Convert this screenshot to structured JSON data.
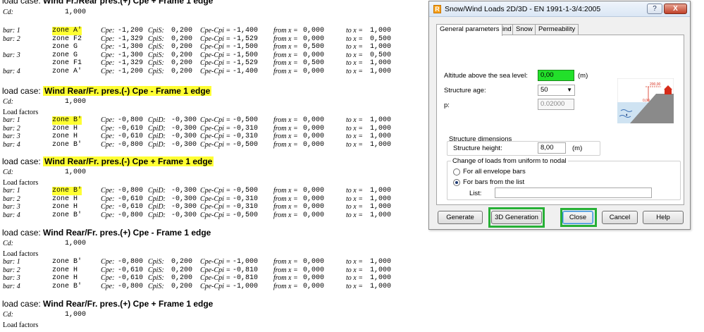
{
  "report": {
    "sections": [
      {
        "title_prefix": "load case:",
        "title": "Wind Fr./Rear pres.(+) Cpe + Frame 1 edge",
        "title_highlight": false,
        "cd_label": "Cd:",
        "cd_value": "1,000",
        "load_factors_label": null,
        "rows": [
          {
            "bar": "bar: 1",
            "zone": "zone A'",
            "zone_highlight": true,
            "cpe_label": "Cpe:",
            "cpe": "-1,200",
            "cpi_label": "CpiS:",
            "cpi": "0,200",
            "pmi_label": "Cpe-Cpi =",
            "pmi": "-1,400",
            "from_label": "from x =",
            "from": "0,000",
            "to_label": "to x =",
            "to": "1,000"
          },
          {
            "bar": "bar: 2",
            "zone": "zone F2",
            "zone_highlight": false,
            "cpe_label": "Cpe:",
            "cpe": "-1,329",
            "cpi_label": "CpiS:",
            "cpi": "0,200",
            "pmi_label": "Cpe-Cpi =",
            "pmi": "-1,529",
            "from_label": "from x =",
            "from": "0,000",
            "to_label": "to x =",
            "to": "0,500"
          },
          {
            "bar": "",
            "zone": "zone G",
            "zone_highlight": false,
            "cpe_label": "Cpe:",
            "cpe": "-1,300",
            "cpi_label": "CpiS:",
            "cpi": "0,200",
            "pmi_label": "Cpe-Cpi =",
            "pmi": "-1,500",
            "from_label": "from x =",
            "from": "0,500",
            "to_label": "to x =",
            "to": "1,000"
          },
          {
            "bar": "bar: 3",
            "zone": "zone G",
            "zone_highlight": false,
            "cpe_label": "Cpe:",
            "cpe": "-1,300",
            "cpi_label": "CpiS:",
            "cpi": "0,200",
            "pmi_label": "Cpe-Cpi =",
            "pmi": "-1,500",
            "from_label": "from x =",
            "from": "0,000",
            "to_label": "to x =",
            "to": "0,500"
          },
          {
            "bar": "",
            "zone": "zone F1",
            "zone_highlight": false,
            "cpe_label": "Cpe:",
            "cpe": "-1,329",
            "cpi_label": "CpiS:",
            "cpi": "0,200",
            "pmi_label": "Cpe-Cpi =",
            "pmi": "-1,529",
            "from_label": "from x =",
            "from": "0,500",
            "to_label": "to x =",
            "to": "1,000"
          },
          {
            "bar": "bar: 4",
            "zone": "zone A'",
            "zone_highlight": false,
            "cpe_label": "Cpe:",
            "cpe": "-1,200",
            "cpi_label": "CpiS:",
            "cpi": "0,200",
            "pmi_label": "Cpe-Cpi =",
            "pmi": "-1,400",
            "from_label": "from x =",
            "from": "0,000",
            "to_label": "to x =",
            "to": "1,000"
          }
        ]
      },
      {
        "title_prefix": "load case:",
        "title": "Wind Rear/Fr. pres.(-) Cpe - Frame 1 edge",
        "title_highlight": true,
        "cd_label": "Cd:",
        "cd_value": "1,000",
        "load_factors_label": "Load factors",
        "rows": [
          {
            "bar": "bar: 1",
            "zone": "zone B'",
            "zone_highlight": true,
            "cpe_label": "Cpe:",
            "cpe": "-0,800",
            "cpi_label": "CpiD:",
            "cpi": "-0,300",
            "pmi_label": "Cpe-Cpi =",
            "pmi": "-0,500",
            "from_label": "from x =",
            "from": "0,000",
            "to_label": "to x =",
            "to": "1,000"
          },
          {
            "bar": "bar: 2",
            "zone": "zone H",
            "zone_highlight": false,
            "cpe_label": "Cpe:",
            "cpe": "-0,610",
            "cpi_label": "CpiD:",
            "cpi": "-0,300",
            "pmi_label": "Cpe-Cpi =",
            "pmi": "-0,310",
            "from_label": "from x =",
            "from": "0,000",
            "to_label": "to x =",
            "to": "1,000"
          },
          {
            "bar": "bar: 3",
            "zone": "zone H",
            "zone_highlight": false,
            "cpe_label": "Cpe:",
            "cpe": "-0,610",
            "cpi_label": "CpiD:",
            "cpi": "-0,300",
            "pmi_label": "Cpe-Cpi =",
            "pmi": "-0,310",
            "from_label": "from x =",
            "from": "0,000",
            "to_label": "to x =",
            "to": "1,000"
          },
          {
            "bar": "bar: 4",
            "zone": "zone B'",
            "zone_highlight": false,
            "cpe_label": "Cpe:",
            "cpe": "-0,800",
            "cpi_label": "CpiD:",
            "cpi": "-0,300",
            "pmi_label": "Cpe-Cpi =",
            "pmi": "-0,500",
            "from_label": "from x =",
            "from": "0,000",
            "to_label": "to x =",
            "to": "1,000"
          }
        ]
      },
      {
        "title_prefix": "load case:",
        "title": "Wind Rear/Fr. pres.(-) Cpe + Frame 1 edge",
        "title_highlight": true,
        "cd_label": "Cd:",
        "cd_value": "1,000",
        "load_factors_label": "Load factors",
        "rows": [
          {
            "bar": "bar: 1",
            "zone": "zone B'",
            "zone_highlight": true,
            "cpe_label": "Cpe:",
            "cpe": "-0,800",
            "cpi_label": "CpiD:",
            "cpi": "-0,300",
            "pmi_label": "Cpe-Cpi =",
            "pmi": "-0,500",
            "from_label": "from x =",
            "from": "0,000",
            "to_label": "to x =",
            "to": "1,000"
          },
          {
            "bar": "bar: 2",
            "zone": "zone H",
            "zone_highlight": false,
            "cpe_label": "Cpe:",
            "cpe": "-0,610",
            "cpi_label": "CpiD:",
            "cpi": "-0,300",
            "pmi_label": "Cpe-Cpi =",
            "pmi": "-0,310",
            "from_label": "from x =",
            "from": "0,000",
            "to_label": "to x =",
            "to": "1,000"
          },
          {
            "bar": "bar: 3",
            "zone": "zone H",
            "zone_highlight": false,
            "cpe_label": "Cpe:",
            "cpe": "-0,610",
            "cpi_label": "CpiD:",
            "cpi": "-0,300",
            "pmi_label": "Cpe-Cpi =",
            "pmi": "-0,310",
            "from_label": "from x =",
            "from": "0,000",
            "to_label": "to x =",
            "to": "1,000"
          },
          {
            "bar": "bar: 4",
            "zone": "zone B'",
            "zone_highlight": false,
            "cpe_label": "Cpe:",
            "cpe": "-0,800",
            "cpi_label": "CpiD:",
            "cpi": "-0,300",
            "pmi_label": "Cpe-Cpi =",
            "pmi": "-0,500",
            "from_label": "from x =",
            "from": "0,000",
            "to_label": "to x =",
            "to": "1,000"
          }
        ]
      },
      {
        "title_prefix": "load case:",
        "title": "Wind Rear/Fr. pres.(+) Cpe - Frame 1 edge",
        "title_highlight": false,
        "cd_label": "Cd:",
        "cd_value": "1,000",
        "load_factors_label": "Load factors",
        "rows": [
          {
            "bar": "bar: 1",
            "zone": "zone B'",
            "zone_highlight": false,
            "cpe_label": "Cpe:",
            "cpe": "-0,800",
            "cpi_label": "CpiS:",
            "cpi": "0,200",
            "pmi_label": "Cpe-Cpi =",
            "pmi": "-1,000",
            "from_label": "from x =",
            "from": "0,000",
            "to_label": "to x =",
            "to": "1,000"
          },
          {
            "bar": "bar: 2",
            "zone": "zone H",
            "zone_highlight": false,
            "cpe_label": "Cpe:",
            "cpe": "-0,610",
            "cpi_label": "CpiS:",
            "cpi": "0,200",
            "pmi_label": "Cpe-Cpi =",
            "pmi": "-0,810",
            "from_label": "from x =",
            "from": "0,000",
            "to_label": "to x =",
            "to": "1,000"
          },
          {
            "bar": "bar: 3",
            "zone": "zone H",
            "zone_highlight": false,
            "cpe_label": "Cpe:",
            "cpe": "-0,610",
            "cpi_label": "CpiS:",
            "cpi": "0,200",
            "pmi_label": "Cpe-Cpi =",
            "pmi": "-0,810",
            "from_label": "from x =",
            "from": "0,000",
            "to_label": "to x =",
            "to": "1,000"
          },
          {
            "bar": "bar: 4",
            "zone": "zone B'",
            "zone_highlight": false,
            "cpe_label": "Cpe:",
            "cpe": "-0,800",
            "cpi_label": "CpiS:",
            "cpi": "0,200",
            "pmi_label": "Cpe-Cpi =",
            "pmi": "-1,000",
            "from_label": "from x =",
            "from": "0,000",
            "to_label": "to x =",
            "to": "1,000"
          }
        ]
      },
      {
        "title_prefix": "load case:",
        "title": "Wind Rear/Fr. pres.(+) Cpe + Frame 1 edge",
        "title_highlight": false,
        "cd_label": "Cd:",
        "cd_value": "1,000",
        "load_factors_label": "Load factors",
        "rows": []
      }
    ]
  },
  "dialog": {
    "app_icon_letter": "R",
    "title": "Snow/Wind Loads 2D/3D - EN 1991-1-3/4:2005",
    "help_button": "?",
    "close_button": "X",
    "tabs": [
      "General parameters",
      "Wind",
      "Snow",
      "Permeability"
    ],
    "active_tab": "General parameters",
    "altitude_label": "Altitude above the sea level:",
    "altitude_value": "0,00",
    "altitude_unit": "(m)",
    "structure_age_label": "Structure age:",
    "structure_age_value": "50",
    "p_label": "p:",
    "p_value": "0.02000",
    "structure_dimensions_label": "Structure dimensions",
    "structure_height_label": "Structure height:",
    "structure_height_value": "8,00",
    "structure_height_unit": "(m)",
    "change_group_label": "Change of loads from uniform to nodal",
    "radio_all_label": "For all envelope bars",
    "radio_list_label": "For bars from the list",
    "list_label": "List:",
    "list_value": "",
    "illustration_height_label": "200,00",
    "illustration_base_label": "0,00",
    "buttons": {
      "generate": "Generate",
      "generation_3d": "3D Generation",
      "close": "Close",
      "cancel": "Cancel",
      "help": "Help"
    }
  },
  "colors": {
    "highlight_yellow": "#ffff33",
    "altitude_field_green": "#22e02a",
    "annotation_green": "#27b036",
    "dialog_background": "#f0f0f0"
  }
}
